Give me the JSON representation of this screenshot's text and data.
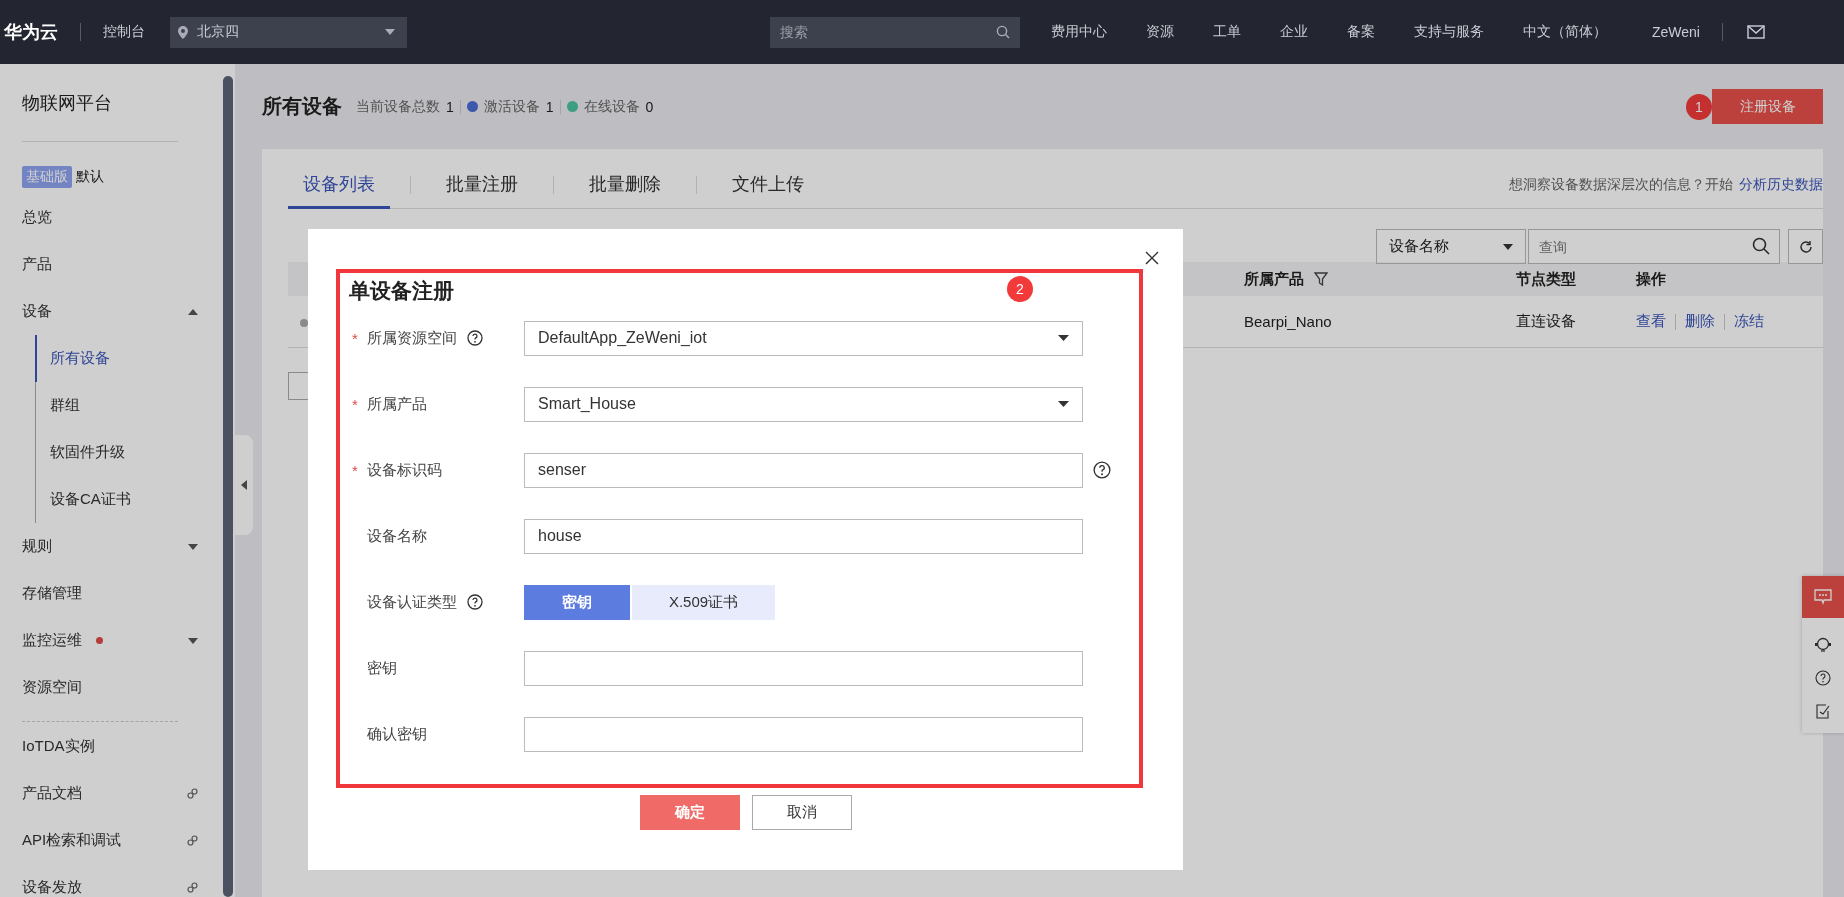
{
  "topbar": {
    "brand": "华为云",
    "console": "控制台",
    "region": "北京四",
    "search_placeholder": "搜索",
    "links": [
      "费用中心",
      "资源",
      "工单",
      "企业",
      "备案",
      "支持与服务",
      "中文（简体）"
    ],
    "user": "ZeWeni"
  },
  "sidebar": {
    "title": "物联网平台",
    "edition_badge": "基础版",
    "edition": "默认",
    "items": [
      {
        "label": "总览",
        "kind": "plain",
        "alert": false
      },
      {
        "label": "产品",
        "kind": "plain",
        "alert": false
      },
      {
        "label": "设备",
        "kind": "group",
        "expanded": true,
        "alert": false,
        "children": [
          {
            "label": "所有设备",
            "selected": true
          },
          {
            "label": "群组",
            "selected": false
          },
          {
            "label": "软固件升级",
            "selected": false
          },
          {
            "label": "设备CA证书",
            "selected": false
          }
        ]
      },
      {
        "label": "规则",
        "kind": "group",
        "expanded": false,
        "alert": false
      },
      {
        "label": "存储管理",
        "kind": "plain",
        "alert": false
      },
      {
        "label": "监控运维",
        "kind": "group",
        "expanded": false,
        "alert": true
      },
      {
        "label": "资源空间",
        "kind": "plain",
        "alert": false
      }
    ],
    "more_items": [
      {
        "label": "IoTDA实例",
        "kind": "plain"
      },
      {
        "label": "产品文档",
        "kind": "link"
      },
      {
        "label": "API检索和调试",
        "kind": "link"
      },
      {
        "label": "设备发放",
        "kind": "link"
      }
    ]
  },
  "page": {
    "title": "所有设备",
    "stats": [
      {
        "label": "当前设备总数",
        "value": "1"
      },
      {
        "label": "激活设备",
        "value": "1",
        "color": "#3c58ac"
      },
      {
        "label": "在线设备",
        "value": "0",
        "color": "#3e9e82"
      }
    ],
    "register_button": "注册设备",
    "step_badge": "1"
  },
  "tabs": [
    {
      "label": "设备列表",
      "selected": true
    },
    {
      "label": "批量注册",
      "selected": false
    },
    {
      "label": "批量删除",
      "selected": false
    },
    {
      "label": "文件上传",
      "selected": false
    }
  ],
  "insight": {
    "text": "想洞察设备数据深层次的信息？开始",
    "link": "分析历史数据"
  },
  "filter": {
    "field": "设备名称",
    "placeholder": "查询"
  },
  "table": {
    "columns": [
      "所属产品",
      "节点类型",
      "操作"
    ],
    "rows": [
      {
        "product": "Bearpi_Nano",
        "node_type": "直连设备",
        "actions": [
          "查看",
          "删除",
          "冻结"
        ]
      }
    ]
  },
  "dialog": {
    "title": "单设备注册",
    "step_badge": "2",
    "fields": [
      {
        "marker": "*",
        "label": "所属资源空间",
        "label_help": true,
        "field_help": false,
        "kind": "select",
        "value": "DefaultApp_ZeWeni_iot"
      },
      {
        "marker": "*",
        "label": "所属产品",
        "label_help": false,
        "field_help": false,
        "kind": "select",
        "value": "Smart_House"
      },
      {
        "marker": "*",
        "label": "设备标识码",
        "label_help": false,
        "field_help": true,
        "kind": "input",
        "value": "senser"
      },
      {
        "label": "设备名称",
        "label_help": false,
        "field_help": false,
        "kind": "input",
        "value": "house"
      },
      {
        "label": "设备认证类型",
        "label_help": true,
        "field_help": false,
        "kind": "segmented",
        "options": [
          {
            "label": "密钥",
            "selected": true
          },
          {
            "label": "X.509证书",
            "selected": false
          }
        ]
      },
      {
        "label": "密钥",
        "label_help": false,
        "field_help": false,
        "kind": "input"
      },
      {
        "label": "确认密钥",
        "label_help": false,
        "field_help": false,
        "kind": "input"
      }
    ],
    "buttons": [
      {
        "label": "确定",
        "kind": "primary"
      },
      {
        "label": "取消",
        "kind": "default"
      }
    ]
  }
}
